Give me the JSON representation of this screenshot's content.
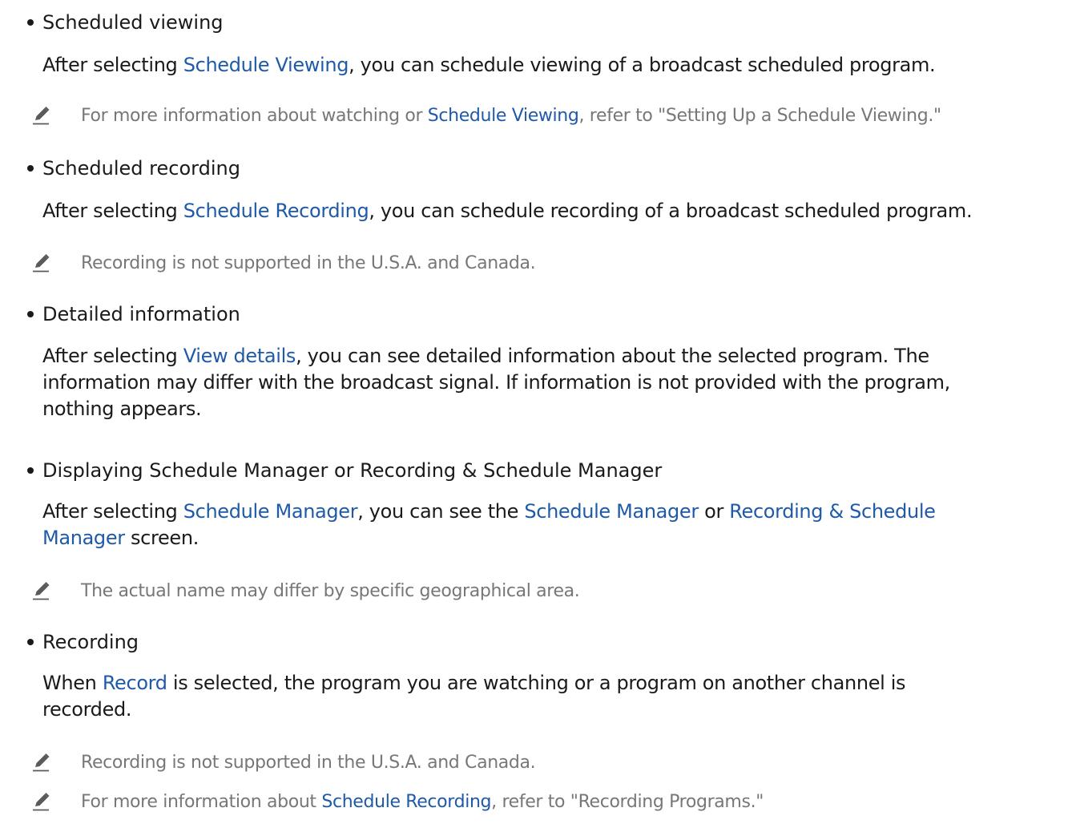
{
  "colors": {
    "text": "#1a1a1a",
    "link": "#1f5aa8",
    "note": "#777777"
  },
  "icons": {
    "note": "pencil-icon"
  },
  "sections": [
    {
      "title": "Scheduled viewing",
      "body": {
        "pre": "After selecting ",
        "link": "Schedule Viewing",
        "post": ", you can schedule viewing of a broadcast scheduled program."
      },
      "notes": [
        {
          "pre": "For more information about watching or ",
          "link": "Schedule Viewing",
          "post": ", refer to \"Setting Up a Schedule Viewing.\""
        }
      ]
    },
    {
      "title": "Scheduled recording",
      "body": {
        "pre": "After selecting ",
        "link": "Schedule Recording",
        "post": ", you can schedule recording of a broadcast scheduled program."
      },
      "notes": [
        {
          "text": "Recording is not supported in the U.S.A. and Canada."
        }
      ]
    },
    {
      "title": "Detailed information",
      "body": {
        "pre": "After selecting ",
        "link": "View details",
        "post_line1": ", you can see detailed information about the selected program. The",
        "line2": "information may differ with the broadcast signal. If information is not provided with the program,",
        "line3": "nothing appears."
      }
    },
    {
      "title": "Displaying Schedule Manager or Recording & Schedule Manager",
      "body": {
        "pre": "After selecting ",
        "link1": "Schedule Manager",
        "mid1": ", you can see the ",
        "link2": "Schedule Manager",
        "mid2": " or ",
        "link3_line1": "Recording & Schedule",
        "link3_line2": "Manager",
        "post": " screen."
      },
      "notes": [
        {
          "text": "The actual name may differ by specific geographical area."
        }
      ]
    },
    {
      "title": "Recording",
      "body": {
        "pre": "When ",
        "link": "Record",
        "post_line1": " is selected, the program you are watching or a program on another channel is",
        "line2": "recorded."
      },
      "notes": [
        {
          "text": "Recording is not supported in the U.S.A. and Canada."
        },
        {
          "pre": "For more information about ",
          "link": "Schedule Recording",
          "post": ", refer to \"Recording Programs.\""
        }
      ]
    }
  ]
}
